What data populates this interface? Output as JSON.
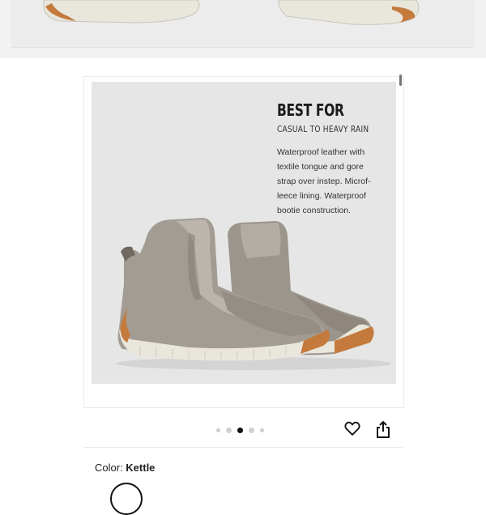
{
  "card": {
    "heading": "BEST FOR",
    "subheading": "CASUAL TO HEAVY RAIN",
    "description_lines": [
      "Waterproof leather with",
      "textile tongue and gore",
      "strap over instep. Microf-",
      "leece lining. Waterproof",
      "bootie construction."
    ]
  },
  "carousel": {
    "dot_count": 5,
    "active_index": 2
  },
  "actions": {
    "favorite_icon": "heart-icon",
    "share_icon": "share-icon"
  },
  "color": {
    "label": "Color:",
    "value": "Kettle"
  },
  "colors": {
    "upper": "#a39c93",
    "sole": "#e9e6dc",
    "gum": "#c47a3c",
    "background": "#e6e6e6"
  }
}
